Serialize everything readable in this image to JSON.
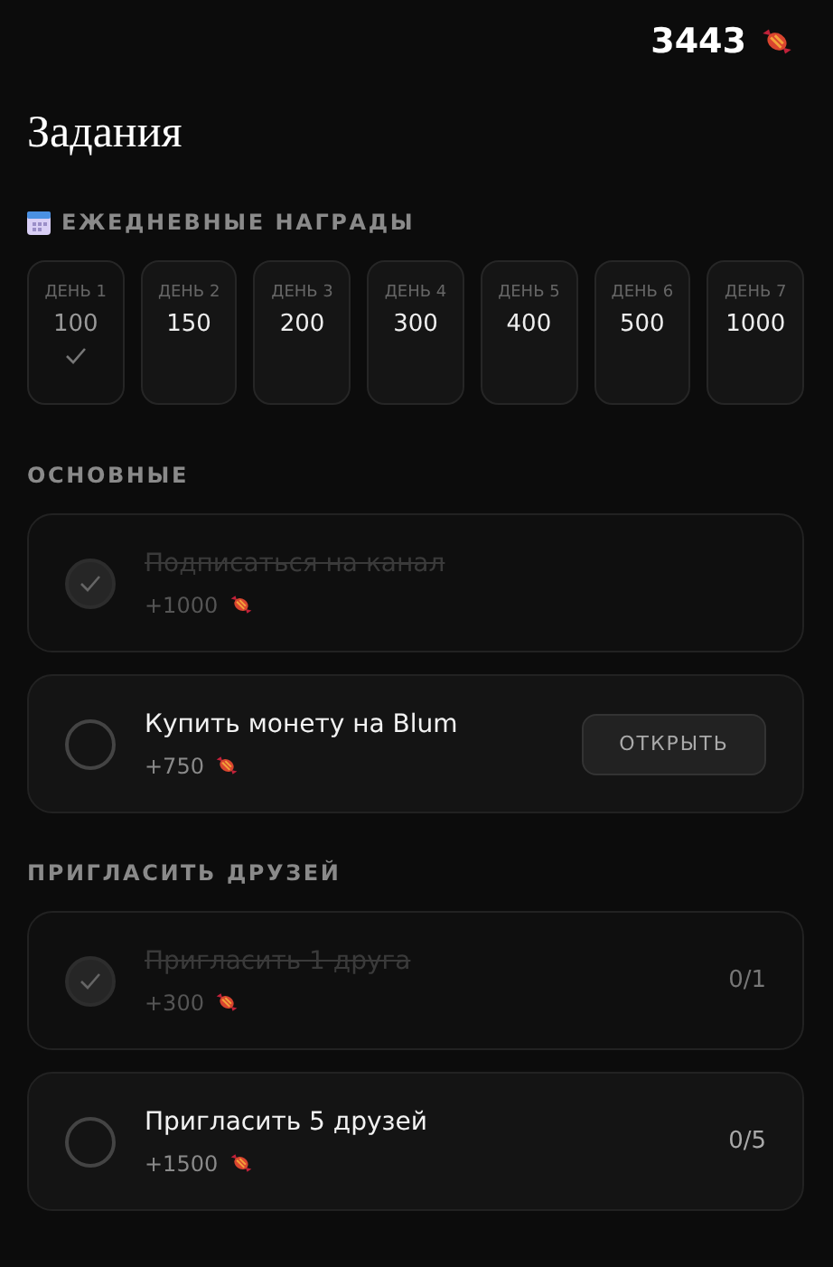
{
  "balance": "3443",
  "title": "Задания",
  "daily": {
    "heading": "ЕЖЕДНЕВНЫЕ НАГРАДЫ",
    "days": [
      {
        "label": "ДЕНЬ 1",
        "amount": "100",
        "claimed": true
      },
      {
        "label": "ДЕНЬ 2",
        "amount": "150",
        "claimed": false
      },
      {
        "label": "ДЕНЬ 3",
        "amount": "200",
        "claimed": false
      },
      {
        "label": "ДЕНЬ 4",
        "amount": "300",
        "claimed": false
      },
      {
        "label": "ДЕНЬ 5",
        "amount": "400",
        "claimed": false
      },
      {
        "label": "ДЕНЬ 6",
        "amount": "500",
        "claimed": false
      },
      {
        "label": "ДЕНЬ 7",
        "amount": "1000",
        "claimed": false
      }
    ]
  },
  "sections": [
    {
      "heading": "ОСНОВНЫЕ",
      "tasks": [
        {
          "title": "Подписаться на канал",
          "reward": "+1000",
          "done": true
        },
        {
          "title": "Купить монету на Blum",
          "reward": "+750",
          "done": false,
          "button": "ОТКРЫТЬ"
        }
      ]
    },
    {
      "heading": "ПРИГЛАСИТЬ ДРУЗЕЙ",
      "tasks": [
        {
          "title": "Пригласить 1 друга",
          "reward": "+300",
          "done": true,
          "progress": "0/1"
        },
        {
          "title": "Пригласить 5 друзей",
          "reward": "+1500",
          "done": false,
          "progress": "0/5"
        }
      ]
    }
  ]
}
